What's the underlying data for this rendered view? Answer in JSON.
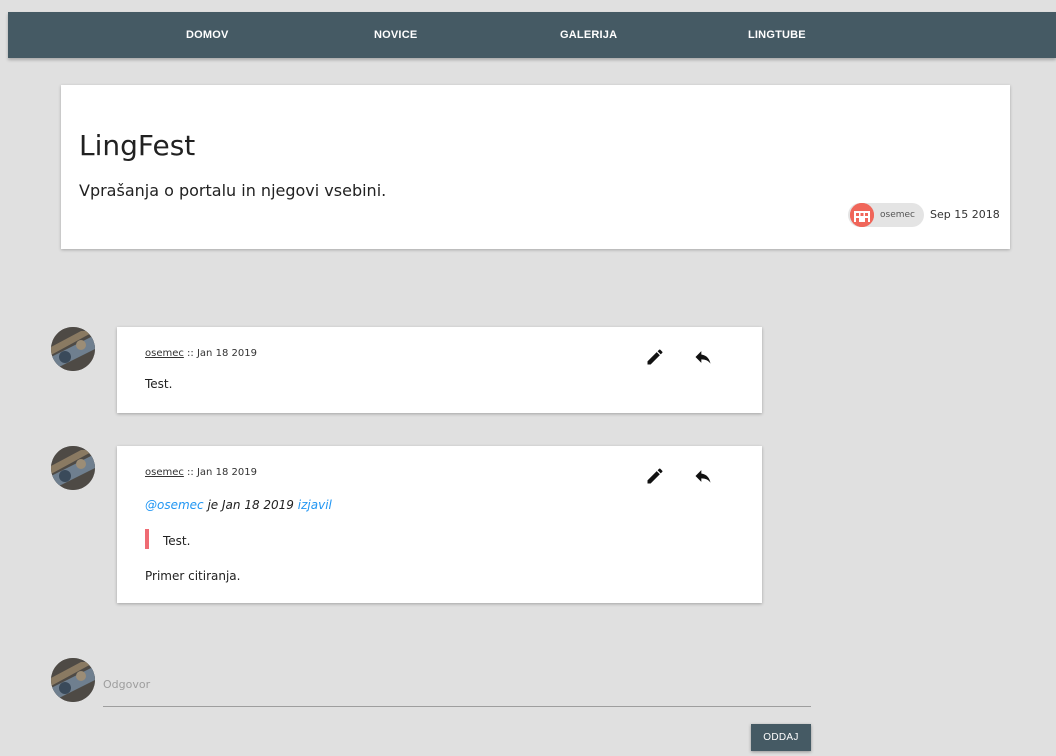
{
  "nav": {
    "items": [
      {
        "label": "DOMOV"
      },
      {
        "label": "NOVICE"
      },
      {
        "label": "GALERIJA"
      },
      {
        "label": "LINGTUBE"
      }
    ]
  },
  "topic": {
    "title": "LingFest",
    "description": "Vprašanja o portalu in njegovi vsebini.",
    "author": "osemec",
    "date": "Sep 15 2018"
  },
  "posts": [
    {
      "user": "osemec",
      "separator": " :: ",
      "date": "Jan 18 2019",
      "body": "Test."
    },
    {
      "user": "osemec",
      "separator": " :: ",
      "date": "Jan 18 2019",
      "quote": {
        "mention": "@osemec",
        "middle": " je Jan 18 2019 ",
        "said_link": "izjavil",
        "text": "Test."
      },
      "body": "Primer citiranja."
    }
  ],
  "reply": {
    "placeholder": "Odgovor",
    "submit_label": "ODDAJ"
  },
  "icons": {
    "edit": "pencil-icon",
    "reply": "reply-arrow-icon"
  },
  "colors": {
    "primary": "#455a64",
    "background": "#e0e0e0",
    "link": "#2196f3",
    "quote_bar": "#ef6b73"
  }
}
